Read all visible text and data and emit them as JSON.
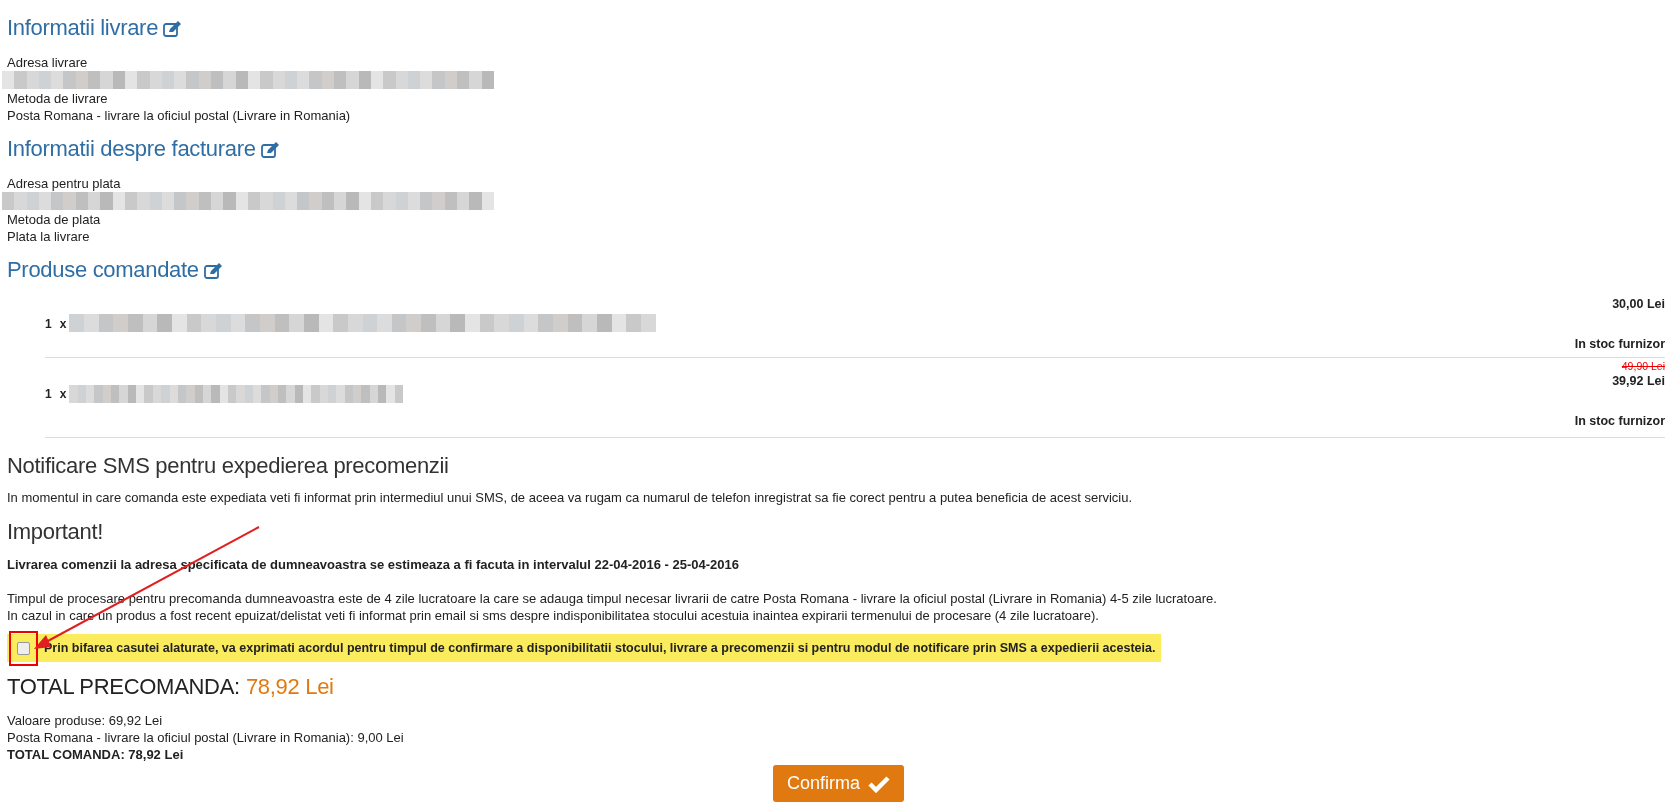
{
  "delivery": {
    "title": "Informatii livrare",
    "fields": [
      {
        "label": "Adresa livrare",
        "kind": "redacted"
      },
      {
        "label": "Metoda de livrare",
        "kind": "text",
        "value": "Posta Romana - livrare la oficiul postal (Livrare in Romania)"
      }
    ]
  },
  "billing": {
    "title": "Informatii despre facturare",
    "fields": [
      {
        "label": "Adresa pentru plata",
        "kind": "redacted"
      },
      {
        "label": "Metoda de plata",
        "kind": "text",
        "value": "Plata la livrare"
      }
    ]
  },
  "products": {
    "title": "Produse comandate",
    "items": [
      {
        "quantity": "1",
        "times": "x",
        "price": "30,00 Lei",
        "stock": "In stoc furnizor"
      },
      {
        "quantity": "1",
        "times": "x",
        "old_price": "49,90 Lei",
        "price": "39,92 Lei",
        "stock": "In stoc furnizor"
      }
    ]
  },
  "sms": {
    "title": "Notificare SMS pentru expedierea precomenzii",
    "text": "In momentul in care comanda este expediata veti fi informat prin intermediul unui SMS, de aceea va rugam ca numarul de telefon inregistrat sa fie corect pentru a putea beneficia de acest serviciu."
  },
  "important": {
    "title": "Important!",
    "estimate": "Livrarea comenzii la adresa specificata de dumneavoastra se estimeaza a fi facuta in intervalul 22-04-2016 - 25-04-2016",
    "lines": [
      "Timpul de procesare pentru precomanda dumneavoastra este de 4 zile lucratoare la care se adauga timpul necesar livrarii de catre Posta Romana - livrare la oficiul postal (Livrare in Romania) 4-5 zile lucratoare.",
      "In cazul in care un produs a fost recent epuizat/delistat veti fi informat prin email si sms despre indisponibilitatea stocului acestuia inaintea expirarii termenului de procesare (4 zile lucratoare)."
    ]
  },
  "agreement": {
    "checked": false,
    "label": "Prin bifarea casutei alaturate, va exprimati acordul pentru timpul de confirmare a disponibilitatii stocului, livrare a precomenzii si pentru modul de notificare prin SMS a expedierii acesteia."
  },
  "total": {
    "label": "TOTAL PRECOMANDA:",
    "amount": "78,92 Lei",
    "lines": [
      {
        "text": "Valoare produse: 69,92 Lei",
        "bold": false
      },
      {
        "text": "Posta Romana - livrare la oficiul postal (Livrare in Romania): 9,00 Lei",
        "bold": false
      },
      {
        "text": "TOTAL COMANDA: 78,92 Lei",
        "bold": true
      }
    ]
  },
  "confirm_button": {
    "label": "Confirma"
  }
}
